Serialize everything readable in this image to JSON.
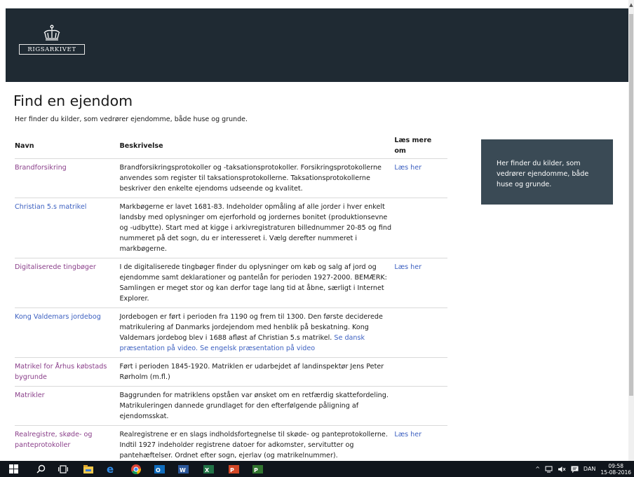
{
  "brand": {
    "logo_text": "Rigsarkivet"
  },
  "page": {
    "title": "Find en ejendom",
    "intro": "Her finder du kilder, som vedrører ejendomme, både huse og grunde."
  },
  "table": {
    "headers": {
      "name": "Navn",
      "desc": "Beskrivelse",
      "more": "Læs mere om"
    },
    "rows": [
      {
        "name": "Brandforsikring",
        "desc": "Brandforsikringsprotokoller og -taksationsprotokoller. Forsikringsprotokollerne anvendes som register til taksationsprotokollerne. Taksationsprotokollerne beskriver den enkelte ejendoms udseende og kvalitet.",
        "more": "Læs her"
      },
      {
        "name": "Christian 5.s matrikel",
        "desc": "Markbøgerne er lavet 1681-83. Indeholder opmåling af alle jorder i hver enkelt landsby med oplysninger om ejerforhold og jordernes bonitet (produktionsevne og -udbytte). Start med at kigge i arkivregistraturen billednummer 20-85 og find nummeret på det sogn, du er interesseret i. Vælg derefter nummeret i markbøgerne.",
        "more": ""
      },
      {
        "name": "Digitaliserede tingbøger",
        "desc": "I de digitaliserede tingbøger finder du oplysninger om køb og salg af jord og ejendomme samt deklarationer og pantelån for perioden 1927-2000. BEMÆRK: Samlingen er meget stor og kan derfor tage lang tid at åbne, særligt i Internet Explorer.",
        "more": "Læs her"
      },
      {
        "name": "Kong Valdemars jordebog",
        "desc": "Jordebogen er ført i perioden fra 1190 og frem til 1300. Den første deciderede matrikulering af Danmarks jordejendom med henblik på beskatning. Kong Valdemars jordebog blev i 1688 afløst af Christian 5.s matrikel.",
        "desc_link1": "Se dansk præsentation på video.",
        "desc_link2": "Se engelsk præsentation på video",
        "more": ""
      },
      {
        "name": "Matrikel for Århus købstads bygrunde",
        "desc": "Ført i perioden 1845-1920. Matriklen er udarbejdet af landinspektør Jens Peter Rørholm (m.fl.)",
        "more": ""
      },
      {
        "name": "Matrikler",
        "desc": "Baggrunden for matriklens opståen var ønsket om en retfærdig skattefordeling. Matrikuleringen dannede grundlaget for den efterfølgende påligning af ejendomsskat.",
        "more": ""
      },
      {
        "name": "Realregistre, skøde- og panteprotokoller",
        "desc": "Realregistrene er en slags indholdsfortegnelse til skøde- og panteprotokollerne. Indtil 1927 indeholder registrene datoer for adkomster, servitutter og pantehæftelser. Ordnet efter sogn, ejerlav (og matrikelnummer).",
        "more": "Læs her"
      }
    ]
  },
  "sidebar": {
    "text": "Her finder du kilder, som vedrører ejendomme, både huse og grunde."
  },
  "taskbar": {
    "language": "DAN",
    "time": "09:58",
    "date": "15-08-2016",
    "apps": [
      "windows-icon",
      "search-icon",
      "task-view-icon",
      "file-explorer-icon",
      "edge-icon",
      "chrome-icon",
      "outlook-icon",
      "word-icon",
      "excel-icon",
      "powerpoint-icon",
      "project-icon"
    ]
  },
  "colors": {
    "header_bg": "#1f2a33",
    "sidebox_bg": "#3a4a55",
    "link": "#3b5fc0",
    "visited_link": "#8a3f8a",
    "taskbar": "#10151c"
  }
}
